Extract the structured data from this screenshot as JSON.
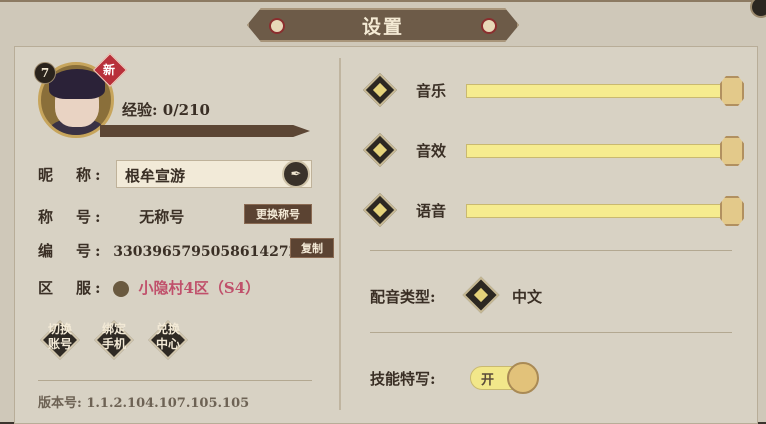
{
  "title": "设置",
  "profile": {
    "level": "7",
    "new_badge": "新",
    "exp_label": "经验: 0/210",
    "exp_fraction": 0,
    "nickname_label": "昵　称:",
    "nickname": "根牟宣游",
    "title_label": "称　号:",
    "title_value": "无称号",
    "change_title_button": "更换称号",
    "id_label": "编　号:",
    "id_value": "3303965795058614272",
    "copy_button": "复制",
    "server_label": "区　服:",
    "server_value": "小隐村4区（S4）",
    "server_value_color": "#c0506b"
  },
  "actions": [
    {
      "label": "切换\n账号"
    },
    {
      "label": "绑定\n手机"
    },
    {
      "label": "兑换\n中心"
    }
  ],
  "version": "版本号: 1.1.2.104.107.105.105",
  "settings": {
    "music_label": "音乐",
    "music_level": 1.0,
    "sfx_label": "音效",
    "sfx_level": 1.0,
    "voice_label": "语音",
    "voice_level": 1.0,
    "dub_type_label": "配音类型:",
    "dub_type_value": "中文",
    "skill_closeup_label": "技能特写:",
    "skill_closeup_toggle": "开"
  },
  "icons": {
    "banner_ornament": "circle-ornament-icon",
    "edit": "pen-icon",
    "server_icon": "server-emblem-icon"
  }
}
